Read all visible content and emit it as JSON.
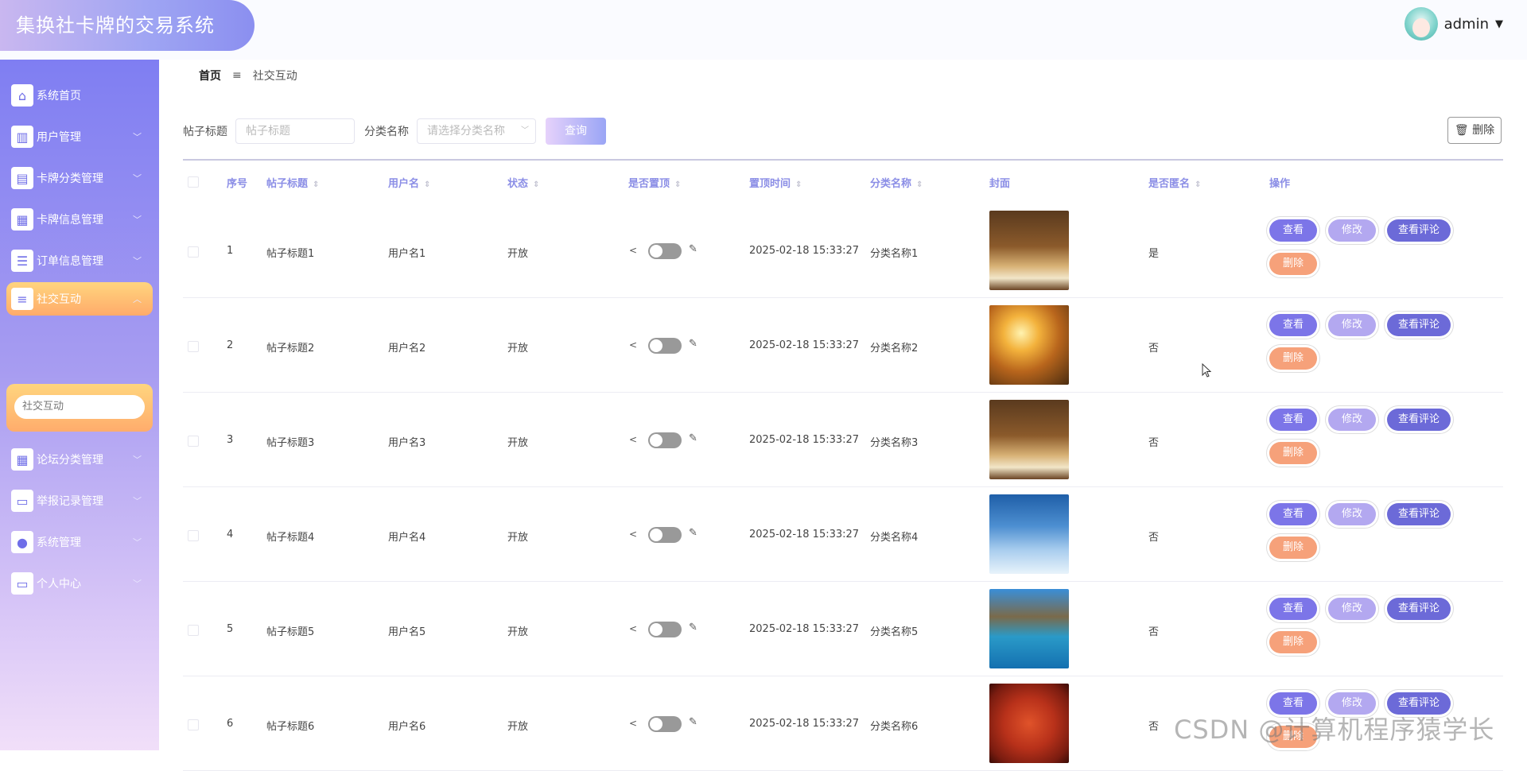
{
  "app": {
    "title": "集换社卡牌的交易系统"
  },
  "user": {
    "name": "admin"
  },
  "sidebar": {
    "items": [
      {
        "label": "系统首页",
        "icon": "home-icon"
      },
      {
        "label": "用户管理",
        "icon": "users-icon"
      },
      {
        "label": "卡牌分类管理",
        "icon": "clipboard-icon"
      },
      {
        "label": "卡牌信息管理",
        "icon": "grid-icon"
      },
      {
        "label": "订单信息管理",
        "icon": "sliders-icon"
      },
      {
        "label": "社交互动",
        "icon": "list-icon"
      },
      {
        "label": "论坛分类管理",
        "icon": "grid-icon"
      },
      {
        "label": "举报记录管理",
        "icon": "monitor-icon"
      },
      {
        "label": "系统管理",
        "icon": "person-icon"
      },
      {
        "label": "个人中心",
        "icon": "card-icon"
      }
    ],
    "submenu": {
      "label": "社交互动"
    }
  },
  "breadcrumb": {
    "home": "首页",
    "separator": "≡",
    "current": "社交互动"
  },
  "search": {
    "title_label": "帖子标题",
    "title_placeholder": "帖子标题",
    "category_label": "分类名称",
    "category_placeholder": "请选择分类名称",
    "query_button": "查询",
    "delete_button": "删除"
  },
  "table": {
    "headers": [
      "序号",
      "帖子标题",
      "用户名",
      "状态",
      "是否置顶",
      "置顶时间",
      "分类名称",
      "封面",
      "是否匿名",
      "操作"
    ],
    "rows": [
      {
        "index": "1",
        "title": "帖子标题1",
        "user": "用户名1",
        "status": "开放",
        "time": "2025-02-18 15:33:27",
        "category": "分类名称1",
        "anonymous": "是"
      },
      {
        "index": "2",
        "title": "帖子标题2",
        "user": "用户名2",
        "status": "开放",
        "time": "2025-02-18 15:33:27",
        "category": "分类名称2",
        "anonymous": "否"
      },
      {
        "index": "3",
        "title": "帖子标题3",
        "user": "用户名3",
        "status": "开放",
        "time": "2025-02-18 15:33:27",
        "category": "分类名称3",
        "anonymous": "否"
      },
      {
        "index": "4",
        "title": "帖子标题4",
        "user": "用户名4",
        "status": "开放",
        "time": "2025-02-18 15:33:27",
        "category": "分类名称4",
        "anonymous": "否"
      },
      {
        "index": "5",
        "title": "帖子标题5",
        "user": "用户名5",
        "status": "开放",
        "time": "2025-02-18 15:33:27",
        "category": "分类名称5",
        "anonymous": "否"
      },
      {
        "index": "6",
        "title": "帖子标题6",
        "user": "用户名6",
        "status": "开放",
        "time": "2025-02-18 15:33:27",
        "category": "分类名称6",
        "anonymous": "否"
      }
    ],
    "ops": {
      "view": "查看",
      "edit": "修改",
      "comment": "查看评论",
      "delete": "删除"
    }
  },
  "watermark": "CSDN @计算机程序猿学长",
  "colors": {
    "accent": "#7c75e8",
    "danger": "#f6a17a",
    "active_menu": "#ffab6a"
  }
}
